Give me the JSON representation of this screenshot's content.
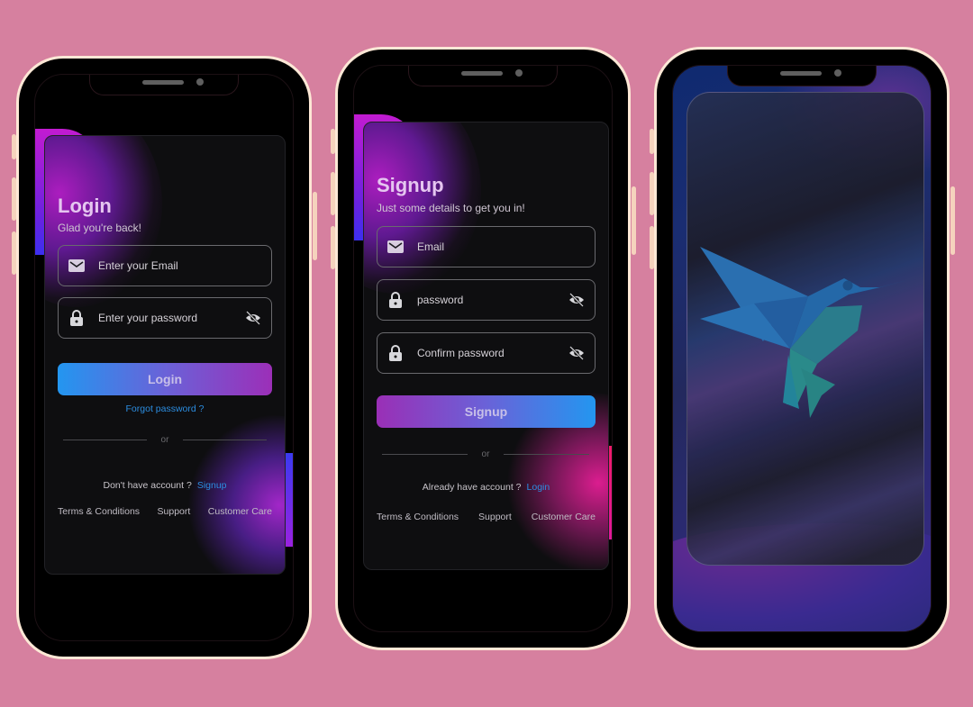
{
  "colors": {
    "background": "#d6809f",
    "phone_frame": "#fde8d6",
    "accent_blue": "#2396f0",
    "accent_purple": "#9c2fb8",
    "link": "#2c8de0",
    "title": "#e5c6f0"
  },
  "login": {
    "title": "Login",
    "subtitle": "Glad you're back!",
    "email_placeholder": "Enter your Email",
    "password_placeholder": "Enter your password",
    "email_icon": "mail-icon",
    "password_icon": "lock-icon",
    "visibility_icon": "eye-off-icon",
    "button_label": "Login",
    "forgot_password": "Forgot password ?",
    "divider": "or",
    "account_prompt": "Don't have account ?",
    "account_link": "Signup",
    "footer_links": [
      "Terms & Conditions",
      "Support",
      "Customer Care"
    ]
  },
  "signup": {
    "title": "Signup",
    "subtitle": "Just some details to get you in!",
    "email_placeholder": "Email",
    "password_placeholder": "password",
    "confirm_placeholder": "Confirm password",
    "email_icon": "mail-icon",
    "password_icon": "lock-icon",
    "visibility_icon": "eye-off-icon",
    "button_label": "Signup",
    "divider": "or",
    "account_prompt": "Already have account ?",
    "account_link": "Login",
    "footer_links": [
      "Terms & Conditions",
      "Support",
      "Customer Care"
    ]
  },
  "splash": {
    "logo": "hummingbird-logo"
  }
}
